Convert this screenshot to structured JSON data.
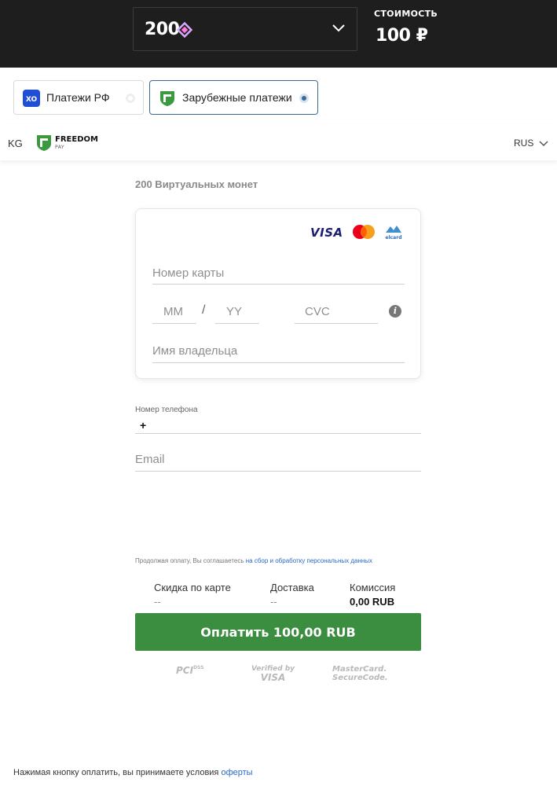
{
  "header": {
    "amount": "200",
    "cost_label": "СТОИМОСТЬ",
    "cost_value": "100 ₽"
  },
  "tabs": [
    {
      "label": "Платежи РФ",
      "selected": false,
      "icon": "xo-icon"
    },
    {
      "label": "Зарубежные платежи",
      "selected": true,
      "icon": "freedom-icon"
    }
  ],
  "provider": {
    "country": "KG",
    "brand": "FREEDOM",
    "brand_sub": "PAY",
    "language": "RUS"
  },
  "product": {
    "title": "200 Виртуальных монет"
  },
  "card_form": {
    "brands": [
      "VISA",
      "mastercard",
      "elcard"
    ],
    "card_number_placeholder": "Номер карты",
    "month_placeholder": "MM",
    "separator": "/",
    "year_placeholder": "YY",
    "cvc_placeholder": "CVC",
    "holder_placeholder": "Имя владельца"
  },
  "contact": {
    "phone_label": "Номер телефона",
    "phone_prefix": "+",
    "email_placeholder": "Email"
  },
  "consent": {
    "text": "Продолжая оплату, Вы соглашаетесь ",
    "link": "на сбор и обработку персональных данных"
  },
  "summary": {
    "discount_label": "Скидка по карте",
    "discount_value": "--",
    "delivery_label": "Доставка",
    "delivery_value": "--",
    "commission_label": "Комиссия",
    "commission_value": "0,00 RUB"
  },
  "pay_button": "Оплатить 100,00 RUB",
  "badges": {
    "pci": "PCI",
    "pci_sub": "DSS",
    "verified_line1": "Verified by",
    "verified_line2": "VISA",
    "mc_line1": "MasterCard.",
    "mc_line2": "SecureCode."
  },
  "footer": {
    "text": "Нажимая кнопку оплатить, вы принимаете условия ",
    "link": "оферты"
  },
  "colors": {
    "topbar": "#1e1e1e",
    "accent_blue": "#3c6a96",
    "pay_green": "#3b8d3f",
    "link": "#2a6ac4"
  }
}
